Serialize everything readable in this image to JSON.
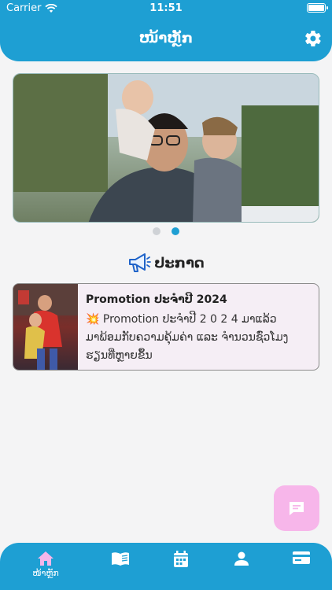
{
  "status_bar": {
    "carrier": "Carrier",
    "time": "11:51"
  },
  "header": {
    "title": "ໜ້າຫຼັກ",
    "settings_icon": "gear-icon"
  },
  "banner": {
    "image": "family-photo",
    "pages": 2,
    "active_page": 2
  },
  "section": {
    "title": "ປະກາດ",
    "icon": "megaphone-icon"
  },
  "promotion": {
    "title": "Promotion ປະຈໍາປີ 2024",
    "line1": "💥 Promotion ປະຈໍາປີ 2 0 2 4 ມາແລ້ວ",
    "line2": "ມາພ້ອມກັບຄວາມຄຸ້ມຄ່າ ແລະ ຈໍານວນຊົ່ວໂມງ",
    "line3": "ຮຽນທີ່ຫຼາຍຂຶ້ນ"
  },
  "fab": {
    "icon": "chat-icon"
  },
  "tabbar": {
    "colors": {
      "bar": "#1e9fd3",
      "active": "#f7b6ea",
      "inactive": "#ffffff"
    },
    "items": [
      {
        "icon": "home-icon",
        "label": "ໜ້າຫຼັກ",
        "active": true
      },
      {
        "icon": "book-icon",
        "label": "",
        "active": false
      },
      {
        "icon": "calendar-icon",
        "label": "",
        "active": false
      },
      {
        "icon": "person-icon",
        "label": "",
        "active": false
      },
      {
        "icon": "card-icon",
        "label": "",
        "active": false
      }
    ]
  }
}
